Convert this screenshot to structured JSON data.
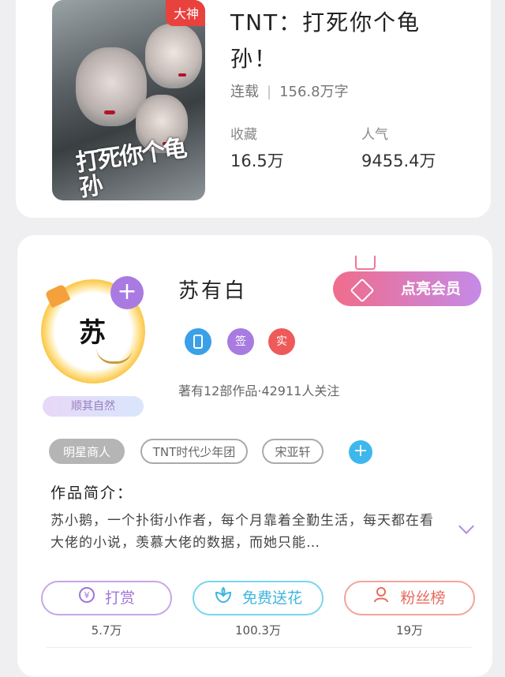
{
  "book": {
    "badge": "大神",
    "cover_title": "打死你个龟孙",
    "title": "TNT：打死你个龟孙！",
    "status": "连载",
    "word_count": "156.8万字",
    "collect_label": "收藏",
    "collect_value": "16.5万",
    "popularity_label": "人气",
    "popularity_value": "9455.4万"
  },
  "author": {
    "avatar_char": "苏",
    "motto": "顺其自然",
    "name": "苏有白",
    "vip_button": "点亮会员",
    "badges": [
      {
        "icon": "phone-badge-icon",
        "color": "#3aa0e8",
        "text": ""
      },
      {
        "icon": "sign-badge-icon",
        "color": "#a77be0",
        "text": "签"
      },
      {
        "icon": "real-badge-icon",
        "color": "#ee5a5a",
        "text": "实"
      }
    ],
    "works_summary": "著有12部作品·42911人关注",
    "tags": [
      "明星商人",
      "TNT时代少年团",
      "宋亚轩"
    ],
    "intro_label": "作品简介：",
    "intro_text": "苏小鹅，一个扑街小作者，每个月靠着全勤生活，每天都在看大佬的小说，羡慕大佬的数据，而她只能…"
  },
  "actions": [
    {
      "label": "打赏",
      "icon": "yen-icon",
      "count": "5.7万"
    },
    {
      "label": "免费送花",
      "icon": "flower-icon",
      "count": "100.3万"
    },
    {
      "label": "粉丝榜",
      "icon": "user-icon",
      "count": "19万"
    }
  ],
  "colors": {
    "vip_gradient_start": "#f06c8b",
    "vip_gradient_end": "#c58ae8",
    "badge_red": "#e8413e",
    "add_tag_blue": "#3eb8ec"
  }
}
